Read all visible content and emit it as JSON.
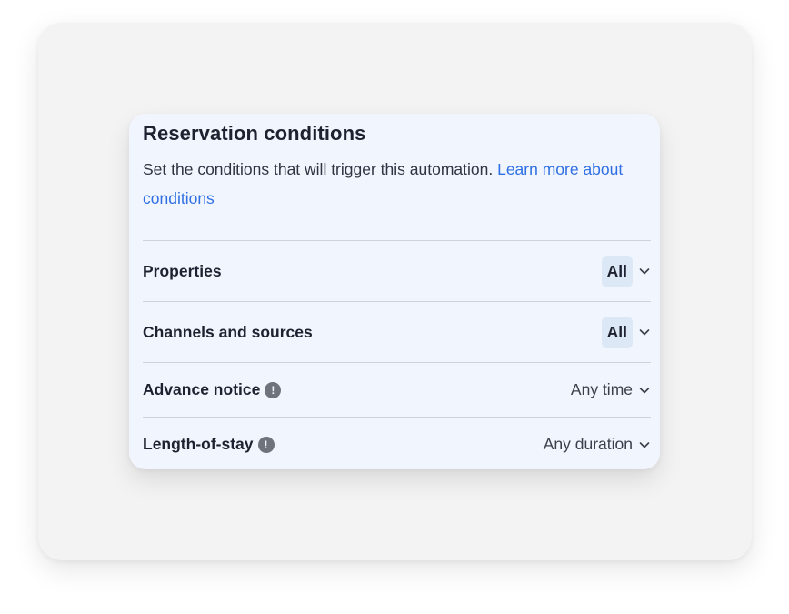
{
  "card": {
    "title": "Reservation conditions",
    "description": "Set the conditions that will trigger this automation.",
    "learn_more": "Learn more about conditions"
  },
  "rows": [
    {
      "label": "Properties",
      "value": "All",
      "has_info": false,
      "style": "pill"
    },
    {
      "label": "Channels and sources",
      "value": "All",
      "has_info": false,
      "style": "pill"
    },
    {
      "label": "Advance notice",
      "value": "Any time",
      "has_info": true,
      "style": "plain"
    },
    {
      "label": "Length-of-stay",
      "value": "Any duration",
      "has_info": true,
      "style": "plain"
    }
  ],
  "icons": {
    "info": "info-icon",
    "dropdown": "chevron-down-icon"
  },
  "colors": {
    "link": "#2f6fe4",
    "card_bg": "#f1f5fd",
    "pill_bg": "#dde8f6"
  }
}
